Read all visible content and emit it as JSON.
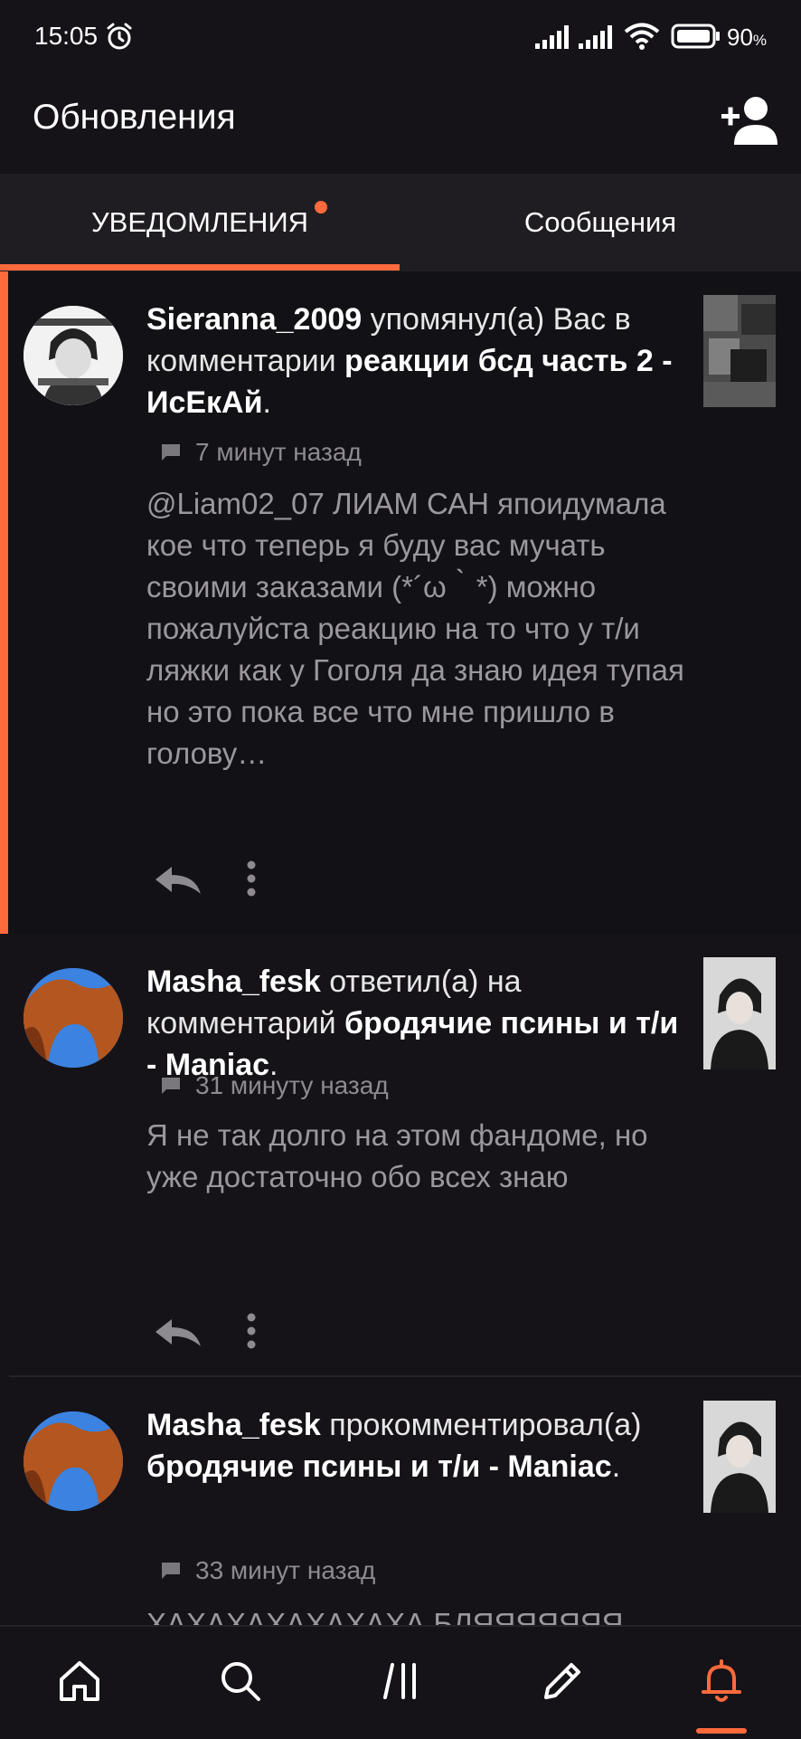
{
  "status_bar": {
    "time": "15:05",
    "battery_percent": "90",
    "battery_unit": "%",
    "icons": [
      "alarm-icon",
      "signal-icon",
      "signal-icon",
      "wifi-icon",
      "battery-icon"
    ]
  },
  "header": {
    "title": "Обновления",
    "action_icon": "add-user-icon"
  },
  "tabs": [
    {
      "label": "УВЕДОМЛЕНИЯ",
      "active": true,
      "has_dot": true
    },
    {
      "label": "Сообщения",
      "active": false,
      "has_dot": false
    }
  ],
  "colors": {
    "accent": "#ff6a3d",
    "background": "#151318",
    "tab_bar": "#1f1d22",
    "muted_text": "#9a989d"
  },
  "notifications": [
    {
      "user": "Sieranna_2009",
      "action": " упомянул(а) Вас в комментарии ",
      "target": "реакции бсд часть 2 - ИсЕкАй",
      "end": ".",
      "time": "7 минут назад",
      "body": "@Liam02_07 ЛИАМ САН япоидумала кое что теперь я буду вас мучать своими заказами (*´ω｀*) можно пожалуйста реакцию на то что у т/и ляжки как у Гоголя да знаю идея тупая но это пока все что мне пришло в голову…",
      "highlighted": true
    },
    {
      "user": "Masha_fesk",
      "action": " ответил(а) на комментарий ",
      "target": "бродячие псины и т/и - Maniac",
      "end": ".",
      "time": "31 минуту назад",
      "body": "Я не так долго на этом фандоме, но уже достаточно обо всех знаю",
      "highlighted": false
    },
    {
      "user": "Masha_fesk",
      "action": " прокомментировал(а) ",
      "target": "бродячие псины и т/и - Maniac",
      "end": ".",
      "time": "33 минут назад",
      "body": "ХАХАХАХАХАХАХА БЛЯЯЯЯЯЯЯ",
      "highlighted": false
    }
  ],
  "bottom_nav": [
    {
      "icon": "home-icon"
    },
    {
      "icon": "search-icon"
    },
    {
      "icon": "library-icon"
    },
    {
      "icon": "pencil-icon"
    },
    {
      "icon": "bell-icon",
      "active": true
    }
  ]
}
